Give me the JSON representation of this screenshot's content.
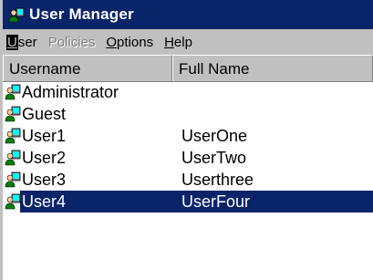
{
  "window": {
    "title": "User Manager"
  },
  "menu": {
    "user": {
      "first": "U",
      "rest": "ser"
    },
    "policies": "Policies",
    "options": {
      "first": "O",
      "rest": "ptions"
    },
    "help": {
      "first": "H",
      "rest": "elp"
    }
  },
  "columns": {
    "username": "Username",
    "fullname": "Full Name"
  },
  "users": [
    {
      "username": "Administrator",
      "fullname": ""
    },
    {
      "username": "Guest",
      "fullname": ""
    },
    {
      "username": "User1",
      "fullname": "UserOne"
    },
    {
      "username": "User2",
      "fullname": "UserTwo"
    },
    {
      "username": "User3",
      "fullname": "Userthree"
    },
    {
      "username": "User4",
      "fullname": "UserFour"
    }
  ],
  "selected_user": "User4",
  "colors": {
    "titlebar": "#0a246a",
    "selection": "#0a246a",
    "chrome": "#c0c0c0"
  },
  "icons": {
    "app": "user-manager-icon",
    "user": "user-icon"
  }
}
